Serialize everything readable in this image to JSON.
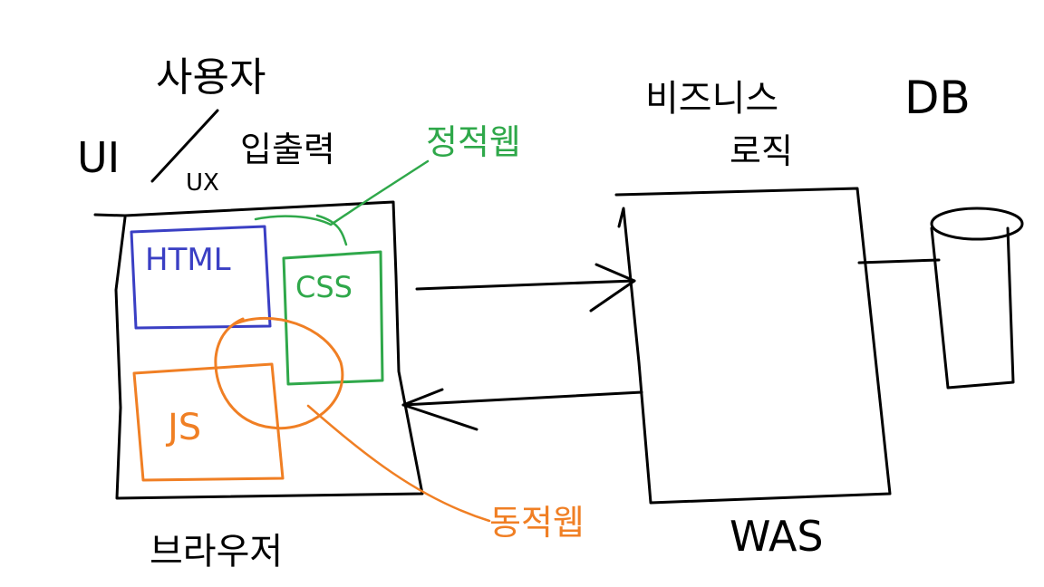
{
  "labels": {
    "user": "사용자",
    "ui": "UI",
    "ux": "UX",
    "io": "입출력",
    "browser": "브라우저",
    "business": "비즈니스",
    "logic": "로직",
    "db": "DB",
    "was": "WAS",
    "static_web": "정적웹",
    "dynamic_web": "동적웹",
    "html": "HTML",
    "css": "CSS",
    "js": "JS"
  },
  "colors": {
    "ink": "#000000",
    "html": "#3a3fc4",
    "css": "#2fa84a",
    "js": "#f07f24"
  }
}
